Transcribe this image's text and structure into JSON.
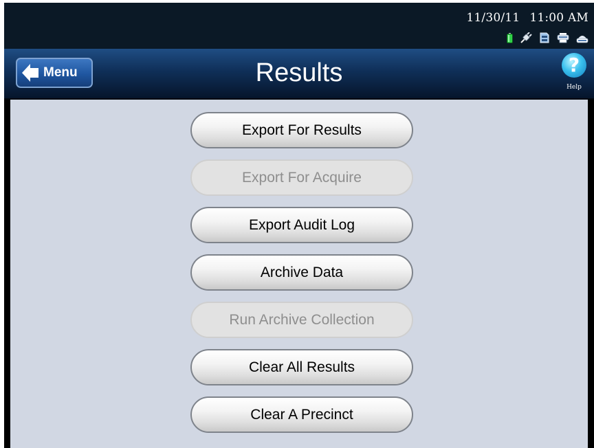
{
  "status_bar": {
    "date": "11/30/11",
    "time": "11:00 AM",
    "icons": [
      "battery-icon",
      "power-plug-icon",
      "memory-card-icon",
      "printer-icon",
      "scanner-icon"
    ]
  },
  "header": {
    "menu_label": "Menu",
    "title": "Results",
    "help_symbol": "?",
    "help_label": "Help"
  },
  "actions": [
    {
      "label": "Export For Results",
      "enabled": true
    },
    {
      "label": "Export For Acquire",
      "enabled": false
    },
    {
      "label": "Export Audit Log",
      "enabled": true
    },
    {
      "label": "Archive Data",
      "enabled": true
    },
    {
      "label": "Run Archive Collection",
      "enabled": false
    },
    {
      "label": "Clear All Results",
      "enabled": true
    },
    {
      "label": "Clear A Precinct",
      "enabled": true
    }
  ],
  "colors": {
    "header_blue": "#0f2f58",
    "content_bg": "#d1d7e3",
    "menu_button": "#1f56a0",
    "help_icon": "#39c0ee",
    "battery_green": "#31d14a"
  }
}
